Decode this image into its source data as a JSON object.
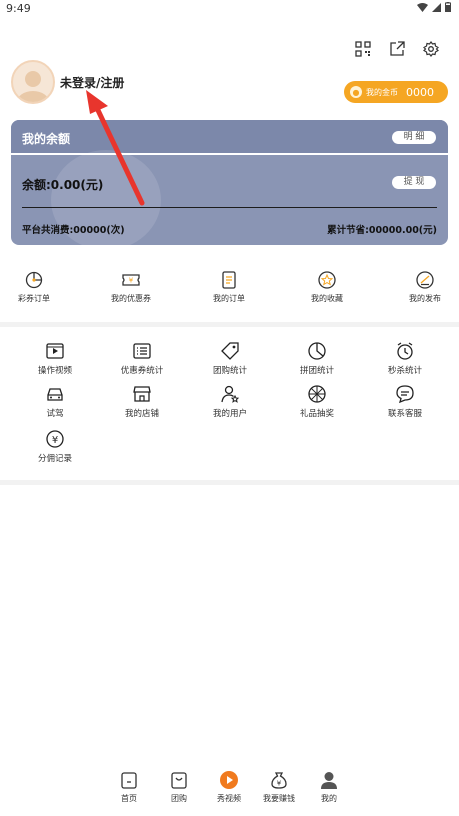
{
  "status_bar": {
    "time": "9:49"
  },
  "top_icons": [
    "qr-code-icon",
    "share-icon",
    "settings-icon"
  ],
  "profile": {
    "login_text": "未登录/注册"
  },
  "coins": {
    "label": "我的金币",
    "value": "0000",
    "color": "#f5a623"
  },
  "balance": {
    "title": "我的余额",
    "detail_label": "明 细",
    "amount": "余额:0.00(元)",
    "withdraw_label": "提 现",
    "total_spend": "平台共消费:00000(次)",
    "total_save": "累计节省:00000.00(元)",
    "card_color": "#8a95b4"
  },
  "orders": [
    {
      "label": "彩券订单",
      "icon": "lottery-icon"
    },
    {
      "label": "我的优惠券",
      "icon": "coupon-icon"
    },
    {
      "label": "我的订单",
      "icon": "order-icon"
    },
    {
      "label": "我的收藏",
      "icon": "favorite-icon"
    },
    {
      "label": "我的发布",
      "icon": "publish-icon"
    }
  ],
  "grid": [
    {
      "label": "操作视频",
      "icon": "video-icon"
    },
    {
      "label": "优惠券统计",
      "icon": "list-icon"
    },
    {
      "label": "团购统计",
      "icon": "tag-icon"
    },
    {
      "label": "拼团统计",
      "icon": "pie-icon"
    },
    {
      "label": "秒杀统计",
      "icon": "clock-icon"
    },
    {
      "label": "试驾",
      "icon": "car-icon"
    },
    {
      "label": "我的店铺",
      "icon": "store-icon"
    },
    {
      "label": "我的用户",
      "icon": "user-star-icon"
    },
    {
      "label": "礼品抽奖",
      "icon": "wheel-icon"
    },
    {
      "label": "联系客服",
      "icon": "chat-icon"
    },
    {
      "label": "分佣记录",
      "icon": "yen-icon"
    }
  ],
  "tabbar": [
    {
      "label": "首页",
      "icon": "home-icon"
    },
    {
      "label": "团购",
      "icon": "bag-icon"
    },
    {
      "label": "秀视频",
      "icon": "play-icon"
    },
    {
      "label": "我要赚钱",
      "icon": "money-bag-icon"
    },
    {
      "label": "我的",
      "icon": "person-icon"
    }
  ]
}
